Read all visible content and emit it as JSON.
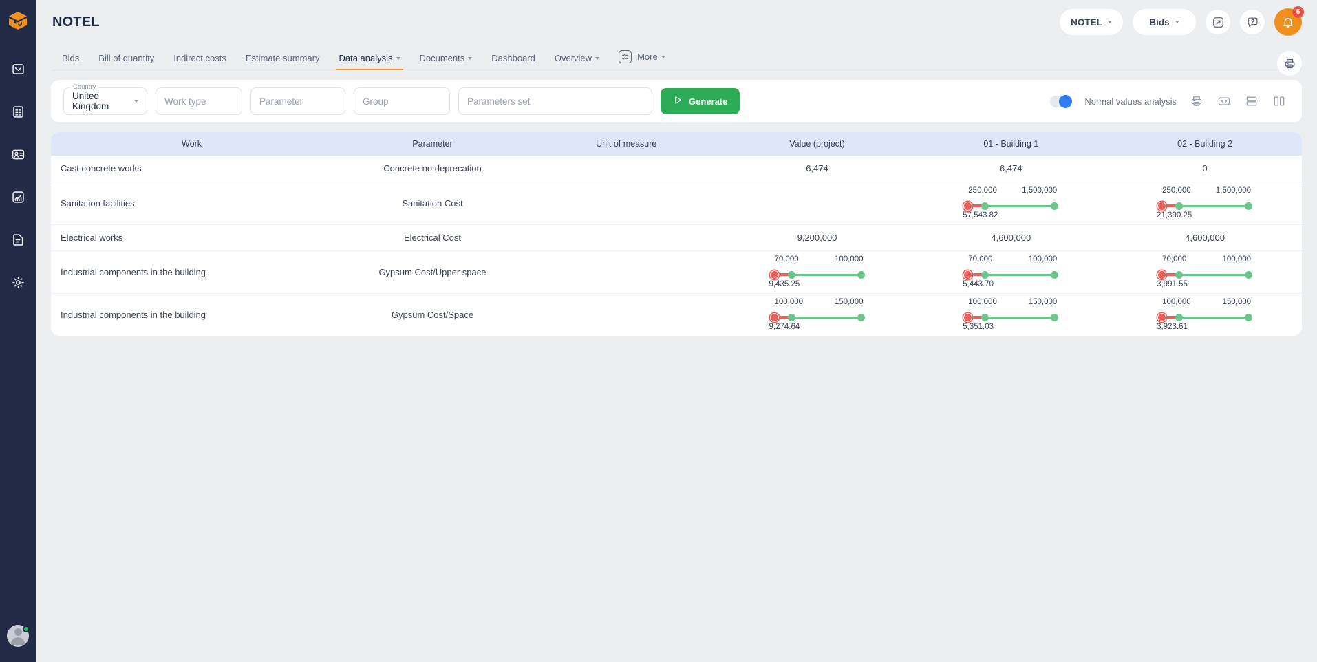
{
  "sidebar": {
    "logo_icon": "cube-box-logo",
    "items": [
      {
        "icon": "envelope-icon",
        "name": "sidebar-item-mail"
      },
      {
        "icon": "list-document-icon",
        "name": "sidebar-item-bill"
      },
      {
        "icon": "contact-card-icon",
        "name": "sidebar-item-contacts"
      },
      {
        "icon": "analytics-chart-icon",
        "name": "sidebar-item-analytics"
      },
      {
        "icon": "file-text-icon",
        "name": "sidebar-item-documents"
      },
      {
        "icon": "gear-icon",
        "name": "sidebar-item-settings"
      }
    ],
    "avatar": {
      "name": "user-avatar",
      "status": "online",
      "status_color": "#27b764"
    }
  },
  "header": {
    "title": "NOTEL",
    "company_select": "NOTEL",
    "section_select": "Bids",
    "expand_icon": "expand-arrows-icon",
    "help_icon": "question-bubble-icon",
    "bell_icon": "bell-icon",
    "notification_count": "5",
    "print_icon": "print-icon",
    "accent_color": "#f2901f",
    "badge_color": "#e8533f"
  },
  "tabs": [
    {
      "label": "Bids",
      "active": false,
      "chevron": false
    },
    {
      "label": "Bill of quantity",
      "active": false,
      "chevron": false
    },
    {
      "label": "Indirect costs",
      "active": false,
      "chevron": false
    },
    {
      "label": "Estimate summary",
      "active": false,
      "chevron": false
    },
    {
      "label": "Data analysis",
      "active": true,
      "chevron": true
    },
    {
      "label": "Documents",
      "active": false,
      "chevron": true
    },
    {
      "label": "Dashboard",
      "active": false,
      "chevron": false
    },
    {
      "label": "Overview",
      "active": false,
      "chevron": true
    },
    {
      "label": "More",
      "active": false,
      "chevron": true,
      "icon": "checklist-icon"
    }
  ],
  "filters": {
    "country": {
      "label": "Country",
      "value": "United Kingdom"
    },
    "work_type": {
      "placeholder": "Work type"
    },
    "parameter": {
      "placeholder": "Parameter"
    },
    "group": {
      "placeholder": "Group"
    },
    "parameters_set": {
      "placeholder": "Parameters set"
    },
    "generate_button": "Generate",
    "generate_color": "#2dab56",
    "toggle": {
      "label": "Normal values analysis",
      "on": true,
      "color": "#2f7ef4"
    },
    "icons": [
      {
        "name": "print-icon"
      },
      {
        "name": "code-brackets-icon"
      },
      {
        "name": "rows-layout-icon"
      },
      {
        "name": "columns-layout-icon"
      }
    ]
  },
  "table": {
    "columns": [
      "Work",
      "Parameter",
      "Unit of measure",
      "Value (project)",
      "01 - Building 1",
      "02 - Building 2"
    ],
    "header_bg": "#dde7f9",
    "rows": [
      {
        "type": "plain",
        "work": "Cast concrete works",
        "parameter": "Concrete no deprecation",
        "unit": "",
        "value_project": "6,474",
        "building_1": "6,474",
        "building_2": "0"
      },
      {
        "type": "slider",
        "work": "Sanitation facilities",
        "parameter": "Sanitation Cost",
        "unit": "",
        "value_project": null,
        "building_1": {
          "min": "250,000",
          "max": "1,500,000",
          "value": "57,543.82"
        },
        "building_2": {
          "min": "250,000",
          "max": "1,500,000",
          "value": "21,390.25"
        }
      },
      {
        "type": "plain",
        "work": "Electrical works",
        "parameter": "Electrical Cost",
        "unit": "",
        "value_project": "9,200,000",
        "building_1": "4,600,000",
        "building_2": "4,600,000"
      },
      {
        "type": "slider",
        "work": "Industrial components in the building",
        "parameter": "Gypsum Cost/Upper space",
        "unit": "",
        "value_project": {
          "min": "70,000",
          "max": "100,000",
          "value": "9,435.25"
        },
        "building_1": {
          "min": "70,000",
          "max": "100,000",
          "value": "5,443.70"
        },
        "building_2": {
          "min": "70,000",
          "max": "100,000",
          "value": "3,991.55"
        }
      },
      {
        "type": "slider",
        "work": "Industrial components in the building",
        "parameter": "Gypsum Cost/Space",
        "unit": "",
        "value_project": {
          "min": "100,000",
          "max": "150,000",
          "value": "9,274.64"
        },
        "building_1": {
          "min": "100,000",
          "max": "150,000",
          "value": "5,351.03"
        },
        "building_2": {
          "min": "100,000",
          "max": "150,000",
          "value": "3,923.61"
        }
      }
    ]
  }
}
